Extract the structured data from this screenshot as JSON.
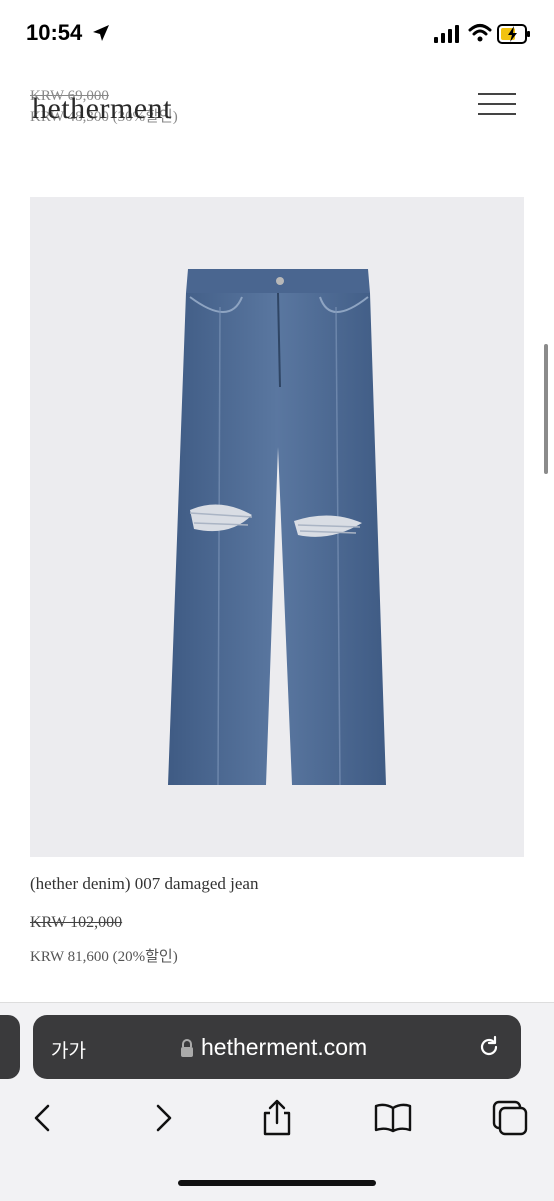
{
  "status_bar": {
    "time": "10:54",
    "icons": [
      "location-arrow-icon",
      "cellular-signal-icon",
      "wifi-icon",
      "battery-charging-icon"
    ]
  },
  "previous_item": {
    "original_price": "KRW 69,000",
    "sale_price": "KRW 48,300 (30%할인)"
  },
  "header": {
    "logo": "hetherment",
    "menu_icon": "hamburger-menu-icon"
  },
  "product": {
    "image": "denim-jeans-product-image",
    "name": "(hether denim) 007 damaged jean",
    "original_price": "KRW 102,000",
    "sale_price": "KRW 81,600 (20%할인)"
  },
  "browser": {
    "text_size_label": "가가",
    "url": "hetherment.com",
    "icons": [
      "lock-icon",
      "reload-icon",
      "back-icon",
      "forward-icon",
      "share-icon",
      "bookmarks-icon",
      "tabs-icon"
    ]
  },
  "colors": {
    "product_bg": "#ececef",
    "denim": "#4f6a90",
    "url_bar": "#3a3a3c"
  }
}
